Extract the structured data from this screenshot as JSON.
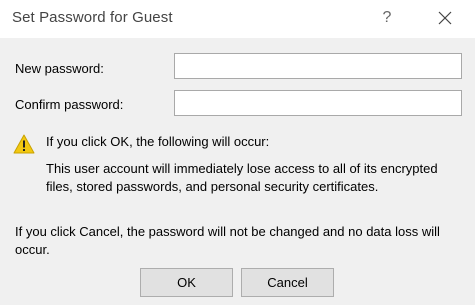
{
  "window": {
    "title": "Set Password for Guest",
    "help_label": "?",
    "help_icon": "question-icon",
    "close_icon": "close-icon"
  },
  "form": {
    "new_password_label": "New password:",
    "new_password_value": "",
    "confirm_password_label": "Confirm password:",
    "confirm_password_value": ""
  },
  "warning": {
    "icon": "warning-icon",
    "icon_color": "#f2c811",
    "heading": "If you click OK, the following will occur:",
    "body_line1": "This user account will immediately lose access to all of its encrypted",
    "body_line2": "files, stored passwords, and personal security certificates."
  },
  "cancel_note": {
    "line1": "If you click Cancel, the password will not be changed and no data loss will",
    "line2": "occur."
  },
  "buttons": {
    "ok_label": "OK",
    "cancel_label": "Cancel"
  }
}
